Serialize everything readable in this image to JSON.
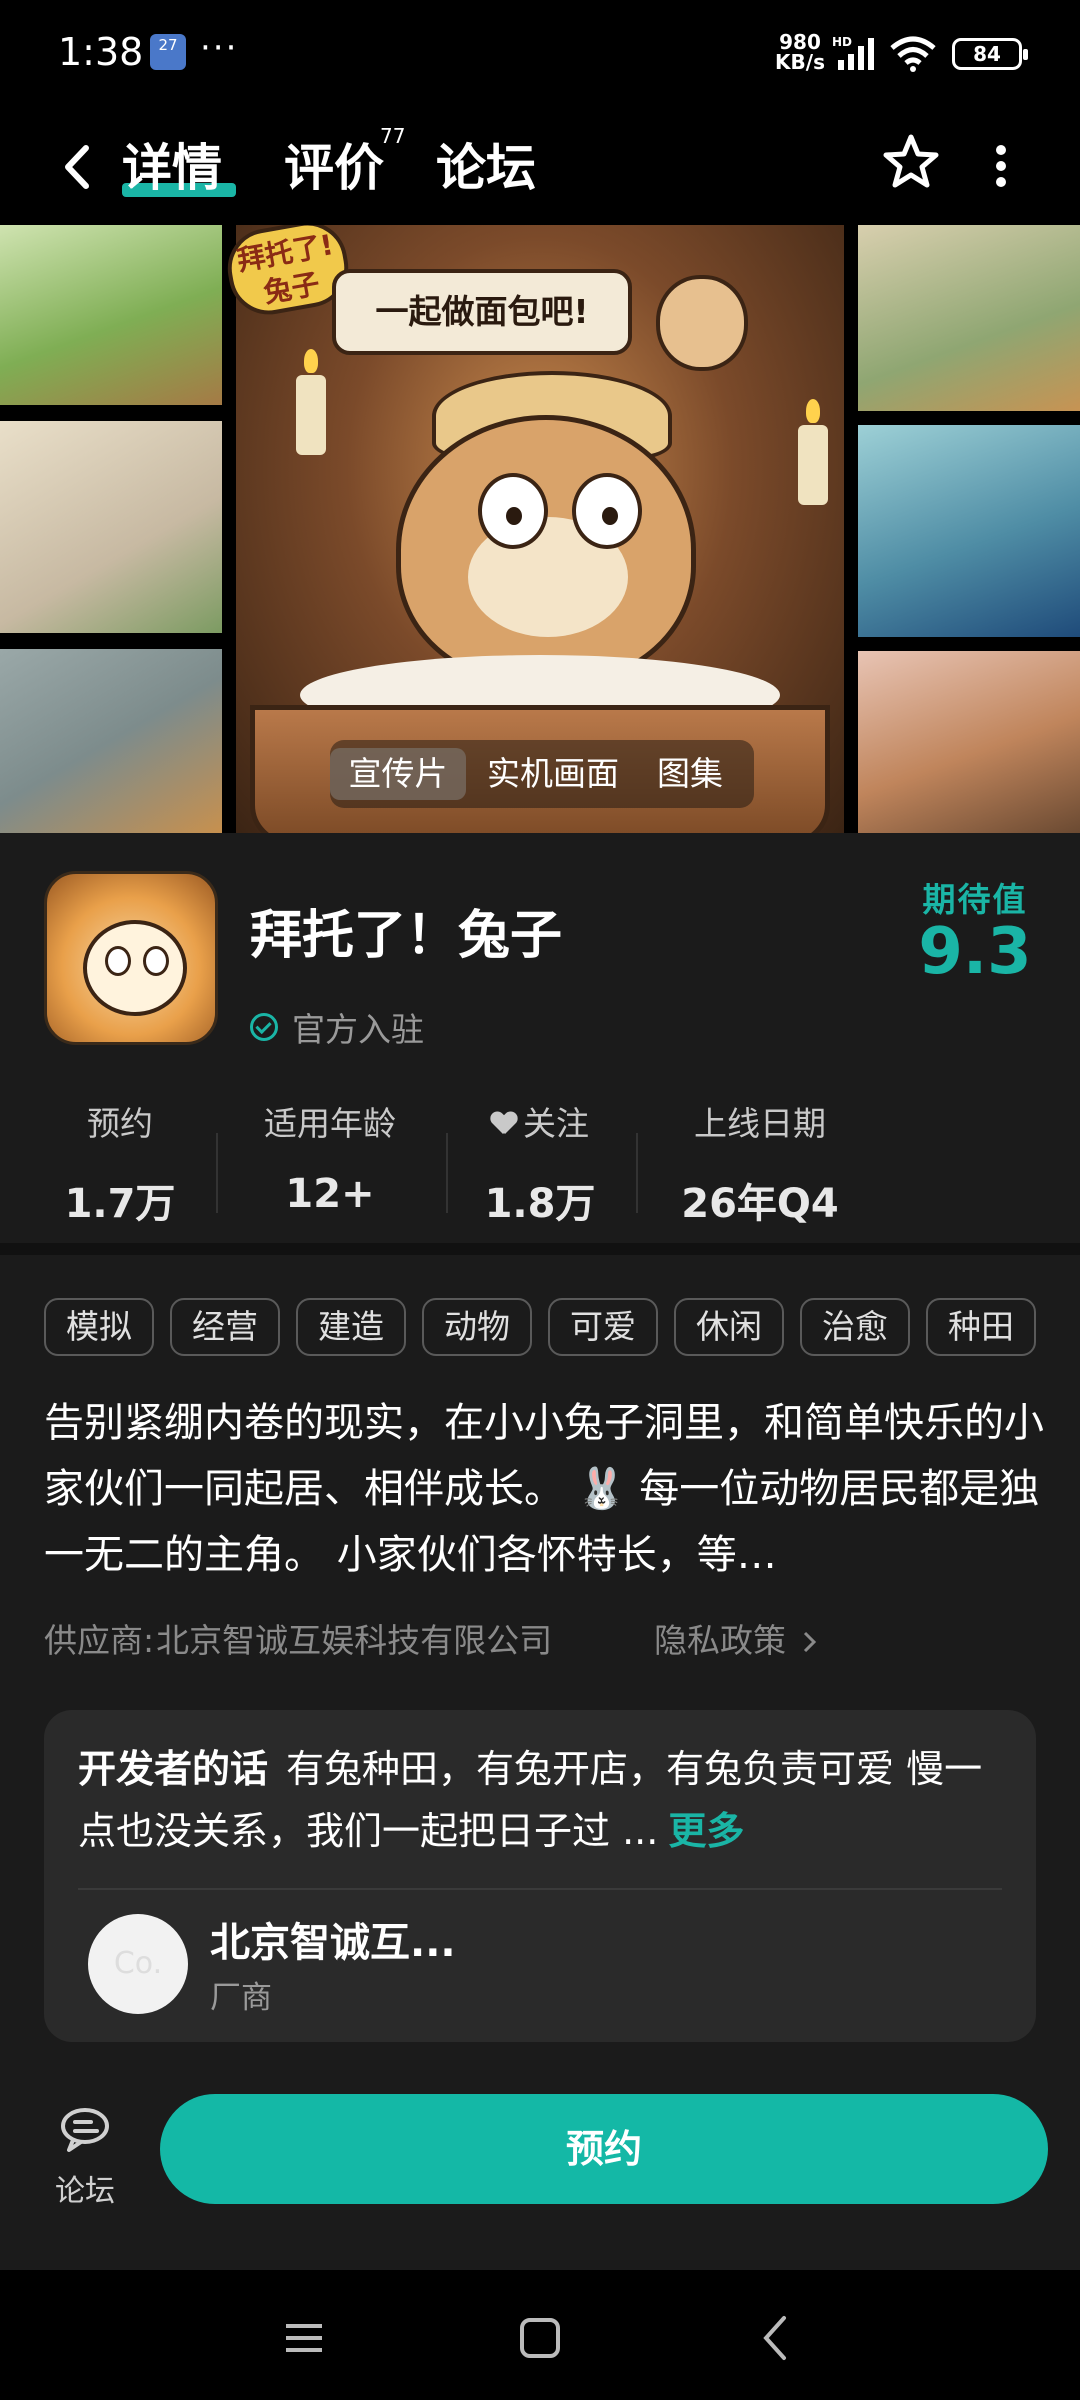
{
  "status_bar": {
    "time": "1:38",
    "notification_badge": "27",
    "more": "···",
    "net_speed": "980",
    "net_unit": "KB/s",
    "network_label": "HD",
    "battery": "84"
  },
  "nav": {
    "tabs": [
      {
        "label": "详情",
        "active": true
      },
      {
        "label": "评价",
        "count": "77"
      },
      {
        "label": "论坛"
      }
    ],
    "icons": [
      "back-icon",
      "star-icon",
      "more-vertical-icon"
    ]
  },
  "gallery": {
    "stamp_text": "拜托了!兔子",
    "speech_text": "一起做面包吧!",
    "media_tabs": [
      "宣传片",
      "实机画面",
      "图集"
    ],
    "active_media_tab": "宣传片"
  },
  "app": {
    "title": "拜托了！兔子",
    "verified_label": "官方入驻",
    "expectation_label": "期待值",
    "expectation_score": "9.3",
    "stats": [
      {
        "label": "预约",
        "value": "1.7万"
      },
      {
        "label": "适用年龄",
        "value": "12+"
      },
      {
        "label": "关注",
        "value": "1.8万",
        "icon": "heart-plus-icon"
      },
      {
        "label": "上线日期",
        "value": "26年Q4"
      }
    ]
  },
  "tags": [
    "模拟",
    "经营",
    "建造",
    "动物",
    "可爱",
    "休闲",
    "治愈",
    "种田"
  ],
  "description": "告别紧绷内卷的现实，在小小兔子洞里，和简单快乐的小家伙们一同起居、相伴成长。 🐰 每一位动物居民都是独一无二的主角。 小家伙们各怀特长，等…",
  "supplier": {
    "label": "供应商:",
    "name": "北京智诚互娱科技有限公司",
    "privacy_label": "隐私政策"
  },
  "developer": {
    "label": "开发者的话",
    "text": "有兔种田，有兔开店，有兔负责可爱 慢一点也没关系，我们一起把日子过 ...",
    "more_label": "更多",
    "avatar_text": "Co.",
    "name": "北京智诚互...",
    "role": "厂商"
  },
  "bottom": {
    "forum_label": "论坛",
    "reserve_label": "预约"
  },
  "colors": {
    "accent": "#14b8a6",
    "background": "#1b1b1b",
    "card": "#2a2a2a"
  }
}
